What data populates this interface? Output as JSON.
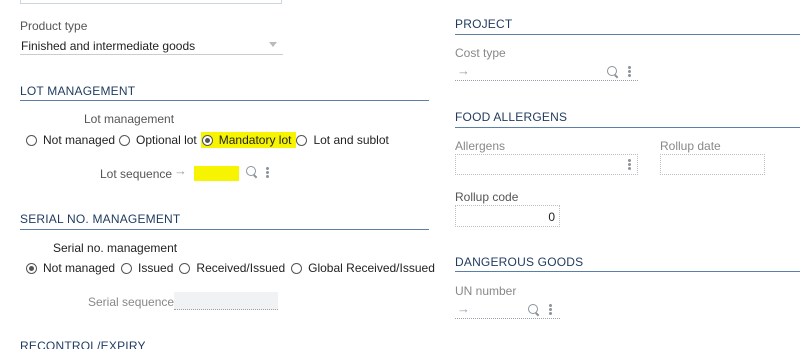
{
  "product_type": {
    "label": "Product type",
    "value": "Finished and intermediate goods"
  },
  "lot_management_section": {
    "title": "LOT MANAGEMENT",
    "field_label": "Lot management",
    "options": [
      "Not managed",
      "Optional lot",
      "Mandatory lot",
      "Lot and sublot"
    ],
    "selected": "Mandatory lot",
    "lot_sequence_label": "Lot sequence",
    "arrow": "→"
  },
  "serial_section": {
    "title": "SERIAL NO. MANAGEMENT",
    "field_label": "Serial no. management",
    "options": [
      "Not managed",
      "Issued",
      "Received/Issued",
      "Global Received/Issued"
    ],
    "selected": "Not managed",
    "serial_sequence_label": "Serial sequence"
  },
  "recontrol_section": {
    "title": "RECONTROL/EXPIRY"
  },
  "project_section": {
    "title": "PROJECT",
    "cost_type_label": "Cost type",
    "arrow": "→"
  },
  "food_allergens_section": {
    "title": "FOOD ALLERGENS",
    "allergens_label": "Allergens",
    "rollup_date_label": "Rollup date",
    "rollup_code_label": "Rollup code",
    "rollup_code_value": "0"
  },
  "dangerous_goods_section": {
    "title": "DANGEROUS GOODS",
    "un_number_label": "UN number",
    "arrow": "→"
  },
  "colors": {
    "section_line": "#5b7fa6",
    "highlight": "#f6f400"
  },
  "icons": [
    "search-icon",
    "kebab-menu-icon",
    "arrow-right-icon",
    "chevron-down-icon",
    "radio-icon"
  ]
}
